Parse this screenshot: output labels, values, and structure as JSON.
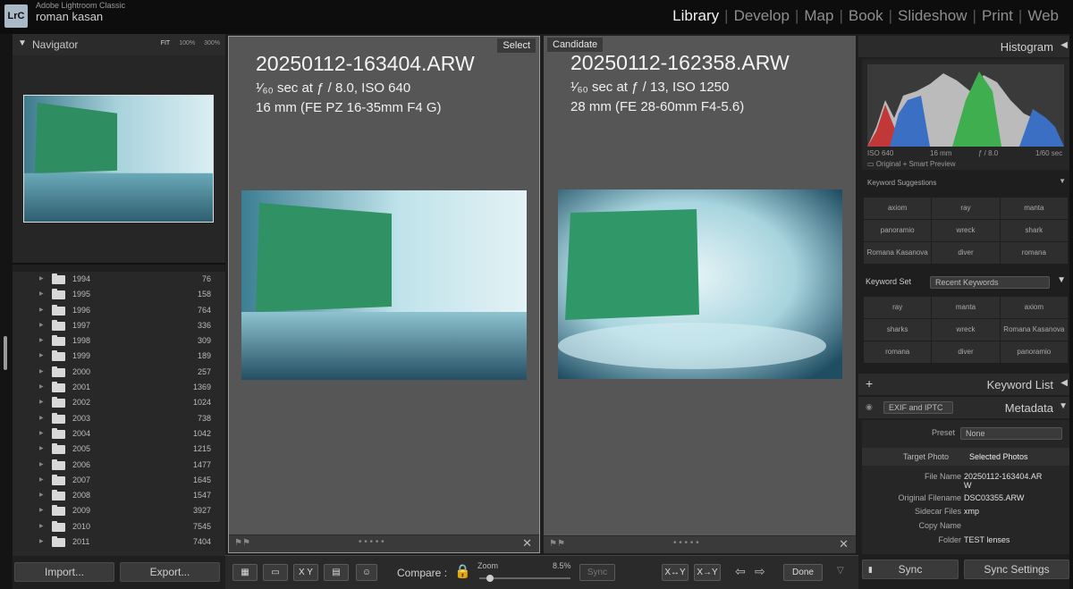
{
  "app": {
    "logo": "LrC",
    "app_name": "Adobe Lightroom Classic",
    "user_name": "roman kasan",
    "modules": [
      "Library",
      "Develop",
      "Map",
      "Book",
      "Slideshow",
      "Print",
      "Web"
    ],
    "active_module": "Library"
  },
  "navigator": {
    "title": "Navigator",
    "zoom_options": [
      "FIT",
      "100%",
      "300%"
    ]
  },
  "folders": [
    {
      "name": "1994",
      "count": "76"
    },
    {
      "name": "1995",
      "count": "158"
    },
    {
      "name": "1996",
      "count": "764"
    },
    {
      "name": "1997",
      "count": "336"
    },
    {
      "name": "1998",
      "count": "309"
    },
    {
      "name": "1999",
      "count": "189"
    },
    {
      "name": "2000",
      "count": "257"
    },
    {
      "name": "2001",
      "count": "1369"
    },
    {
      "name": "2002",
      "count": "1024"
    },
    {
      "name": "2003",
      "count": "738"
    },
    {
      "name": "2004",
      "count": "1042"
    },
    {
      "name": "2005",
      "count": "1215"
    },
    {
      "name": "2006",
      "count": "1477"
    },
    {
      "name": "2007",
      "count": "1645"
    },
    {
      "name": "2008",
      "count": "1547"
    },
    {
      "name": "2009",
      "count": "3927"
    },
    {
      "name": "2010",
      "count": "7545"
    },
    {
      "name": "2011",
      "count": "7404"
    }
  ],
  "left_buttons": {
    "import": "Import...",
    "export": "Export..."
  },
  "compare": {
    "select": {
      "tag": "Select",
      "filename": "20250112-163404.ARW",
      "exif_line1": "¹⁄₆₀ sec at ƒ / 8.0, ISO 640",
      "exif_line2": "16 mm (FE PZ 16-35mm F4 G)"
    },
    "candidate": {
      "tag": "Candidate",
      "filename": "20250112-162358.ARW",
      "exif_line1": "¹⁄₆₀ sec at ƒ / 13, ISO 1250",
      "exif_line2": "28 mm (FE 28-60mm F4-5.6)"
    }
  },
  "toolbar": {
    "compare_label": "Compare :",
    "zoom_label": "Zoom",
    "zoom_value": "8.5%",
    "zoom_level": 0.085,
    "sync_label": "Sync",
    "done_label": "Done",
    "xy_label": "X Y",
    "xy_swap": "X↔Y",
    "xy_next": "X→Y"
  },
  "histogram": {
    "title": "Histogram",
    "iso": "ISO 640",
    "focal": "16 mm",
    "aperture": "ƒ / 8.0",
    "shutter": "1/60 sec",
    "preview": "Original + Smart Preview"
  },
  "keyword_suggestions": {
    "title": "Keyword Suggestions",
    "items": [
      "axiom",
      "ray",
      "manta",
      "panoramio",
      "wreck",
      "shark",
      "Romana Kasanova",
      "diver",
      "romana"
    ]
  },
  "keyword_set": {
    "label": "Keyword Set",
    "value": "Recent Keywords",
    "items": [
      "ray",
      "manta",
      "axiom",
      "sharks",
      "wreck",
      "Romana Kasanova",
      "romana",
      "diver",
      "panoramio"
    ]
  },
  "keyword_list": {
    "title": "Keyword List",
    "plus": "+"
  },
  "metadata": {
    "title": "Metadata",
    "preset_view": "EXIF and IPTC",
    "preset_label": "Preset",
    "preset_value": "None",
    "target_photo": "Target Photo",
    "selected_photos": "Selected Photos",
    "rows": [
      {
        "label": "File Name",
        "value": "20250112-163404.AR\nW"
      },
      {
        "label": "Original Filename",
        "value": "DSC03355.ARW"
      },
      {
        "label": "Sidecar Files",
        "value": "xmp"
      },
      {
        "label": "Copy Name",
        "value": ""
      },
      {
        "label": "Folder",
        "value": "TEST lenses"
      }
    ]
  },
  "right_buttons": {
    "sync": "Sync",
    "sync_settings": "Sync Settings"
  },
  "colors": {
    "accent_green": "#2a8c5a",
    "panel": "#565656"
  }
}
